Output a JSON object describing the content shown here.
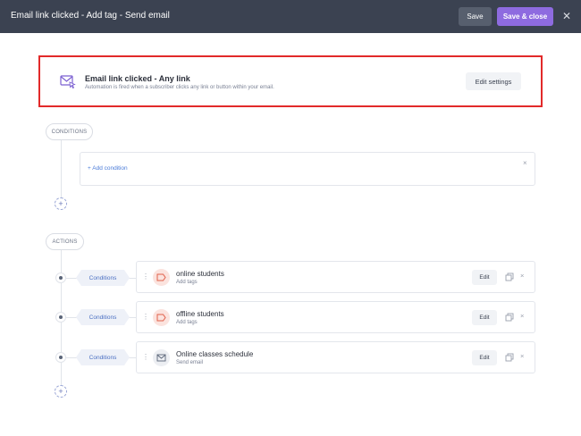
{
  "header": {
    "title": "Email link clicked - Add tag - Send email",
    "save_label": "Save",
    "save_close_label": "Save & close",
    "close_glyph": "✕"
  },
  "trigger": {
    "icon": "email-cursor-icon",
    "title": "Email link clicked - Any link",
    "description": "Automation is fired when a subscriber clicks any link or button within your email.",
    "edit_label": "Edit settings"
  },
  "conditions": {
    "section_label": "CONDITIONS",
    "add_condition_label": "+ Add condition",
    "close_glyph": "×",
    "add_glyph": "+"
  },
  "actions": {
    "section_label": "ACTIONS",
    "add_glyph": "+",
    "items": [
      {
        "condition_label": "Conditions",
        "icon": "tag-icon",
        "title": "online students",
        "subtitle": "Add tags",
        "edit_label": "Edit",
        "close_glyph": "×"
      },
      {
        "condition_label": "Conditions",
        "icon": "tag-icon",
        "title": "offline students",
        "subtitle": "Add tags",
        "edit_label": "Edit",
        "close_glyph": "×"
      },
      {
        "condition_label": "Conditions",
        "icon": "mail-icon",
        "title": "Online classes schedule",
        "subtitle": "Send email",
        "edit_label": "Edit",
        "close_glyph": "×"
      }
    ]
  },
  "colors": {
    "topbar_bg": "#3b4251",
    "primary": "#8e6be0",
    "highlight_border": "#e22a2a",
    "link": "#4a7bd8"
  }
}
